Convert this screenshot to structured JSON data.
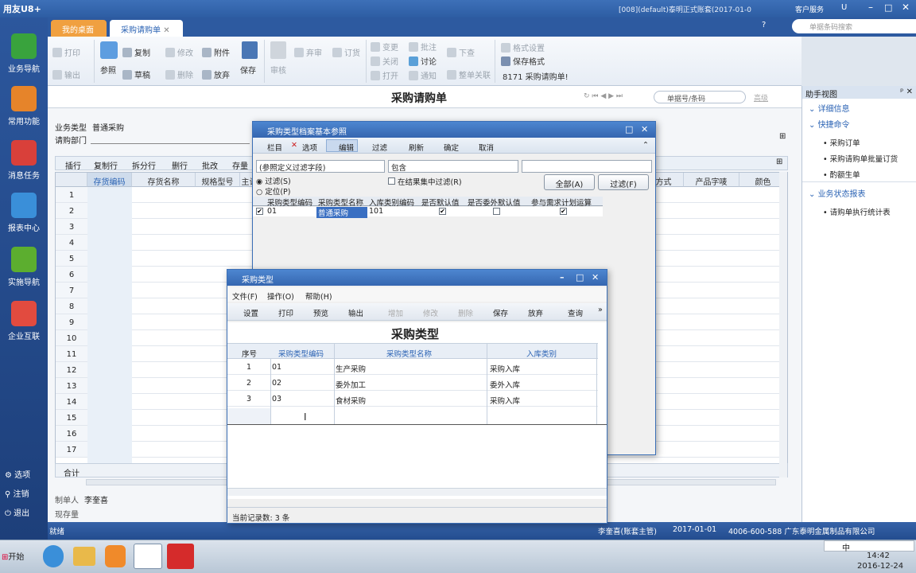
{
  "app": {
    "logo": "用友U8+",
    "account": "[008](default)泰明正式账套(2017-01-0",
    "service": "客户服务",
    "u": "U",
    "search_placeholder": "单据条码搜索"
  },
  "nav": {
    "items": [
      "业务导航",
      "常用功能",
      "消息任务",
      "报表中心",
      "实施导航",
      "企业互联"
    ],
    "options": "选项",
    "logout": "注销",
    "exit": "退出"
  },
  "tabs": [
    "我的桌面",
    "采购请购单"
  ],
  "toolbar": {
    "print": "打印",
    "output": "输出",
    "ref": "参照",
    "copy": "复制",
    "draft": "草稿",
    "modify": "修改",
    "delete": "删除",
    "attach": "附件",
    "abandon": "放弃",
    "save": "保存",
    "audit": "审核",
    "discard": "弃审",
    "order": "订货",
    "change": "变更",
    "close": "关闭",
    "open": "打开",
    "annotate": "批注",
    "discuss": "讨论",
    "notify": "通知",
    "push": "下查",
    "link": "整单关联",
    "fmt_set": "格式设置",
    "save_fmt": "保存格式",
    "fmt_name": "8171 采购请购单!"
  },
  "form": {
    "title": "采购请购单",
    "barcode_placeholder": "单据号/条码",
    "advanced": "高级",
    "biz_type_label": "业务类型",
    "biz_type_value": "普通采购",
    "dept_label": "请购部门",
    "maker_label": "制单人",
    "maker_value": "李奎喜",
    "stock_label": "现存量",
    "total": "合计"
  },
  "grid": {
    "ops": [
      "插行",
      "复制行",
      "拆分行",
      "删行",
      "批改",
      "存量"
    ],
    "headers": [
      "存货编码",
      "存货名称",
      "规格型号",
      "主计",
      "方式",
      "产品字唛",
      "颜色"
    ],
    "rows": [
      "1",
      "2",
      "3",
      "4",
      "5",
      "6",
      "7",
      "8",
      "9",
      "10",
      "11",
      "12",
      "13",
      "14",
      "15",
      "16",
      "17"
    ]
  },
  "helper": {
    "title": "助手视图",
    "detail": "详细信息",
    "quick": "快捷命令",
    "cmds": [
      "采购订单",
      "采购请购单批量订货",
      "酌额生单"
    ],
    "report_title": "业务状态报表",
    "reports": [
      "请购单执行统计表"
    ]
  },
  "ref_dlg": {
    "title": "采购类型档案基本参照",
    "tools": [
      "栏目",
      "选项",
      "编辑",
      "过滤",
      "刷新",
      "确定",
      "取消"
    ],
    "field": "(参照定义过滤字段)",
    "op": "包含",
    "filter_radio": "过滤(S)",
    "locate_radio": "定位(P)",
    "in_result": "在结果集中过滤(R)",
    "all_btn": "全部(A)",
    "filter_btn": "过滤(F)",
    "headers": [
      "采购类型编码",
      "采购类型名称",
      "入库类别编码",
      "是否默认值",
      "是否委外默认值",
      "参与需求计划运算"
    ],
    "rows": [
      {
        "code": "01",
        "name": "普通采购",
        "in_code": "101",
        "is_default": true,
        "is_outsource": false,
        "mrp": true
      }
    ]
  },
  "type_dlg": {
    "title": "采购类型",
    "menus": [
      "文件(F)",
      "操作(O)",
      "帮助(H)"
    ],
    "tools": [
      "设置",
      "打印",
      "预览",
      "输出",
      "增加",
      "修改",
      "删除",
      "保存",
      "放弃",
      "查询"
    ],
    "heading": "采购类型",
    "headers": [
      "序号",
      "采购类型编码",
      "采购类型名称",
      "入库类别"
    ],
    "rows": [
      {
        "no": "1",
        "code": "01",
        "name": "生产采购",
        "cat": "采购入库"
      },
      {
        "no": "2",
        "code": "02",
        "name": "委外加工",
        "cat": "委外入库"
      },
      {
        "no": "3",
        "code": "03",
        "name": "食材采购",
        "cat": "采购入库"
      }
    ],
    "status": "当前记录数:  3 条"
  },
  "status": {
    "ready": "就绪",
    "user": "李奎喜(账套主管)",
    "date": "2017-01-01",
    "phone": "4006-600-588 广东泰明金属制品有限公司"
  },
  "taskbar": {
    "start": "开始",
    "time": "14:42",
    "date": "2016-12-24",
    "ime": "中"
  }
}
